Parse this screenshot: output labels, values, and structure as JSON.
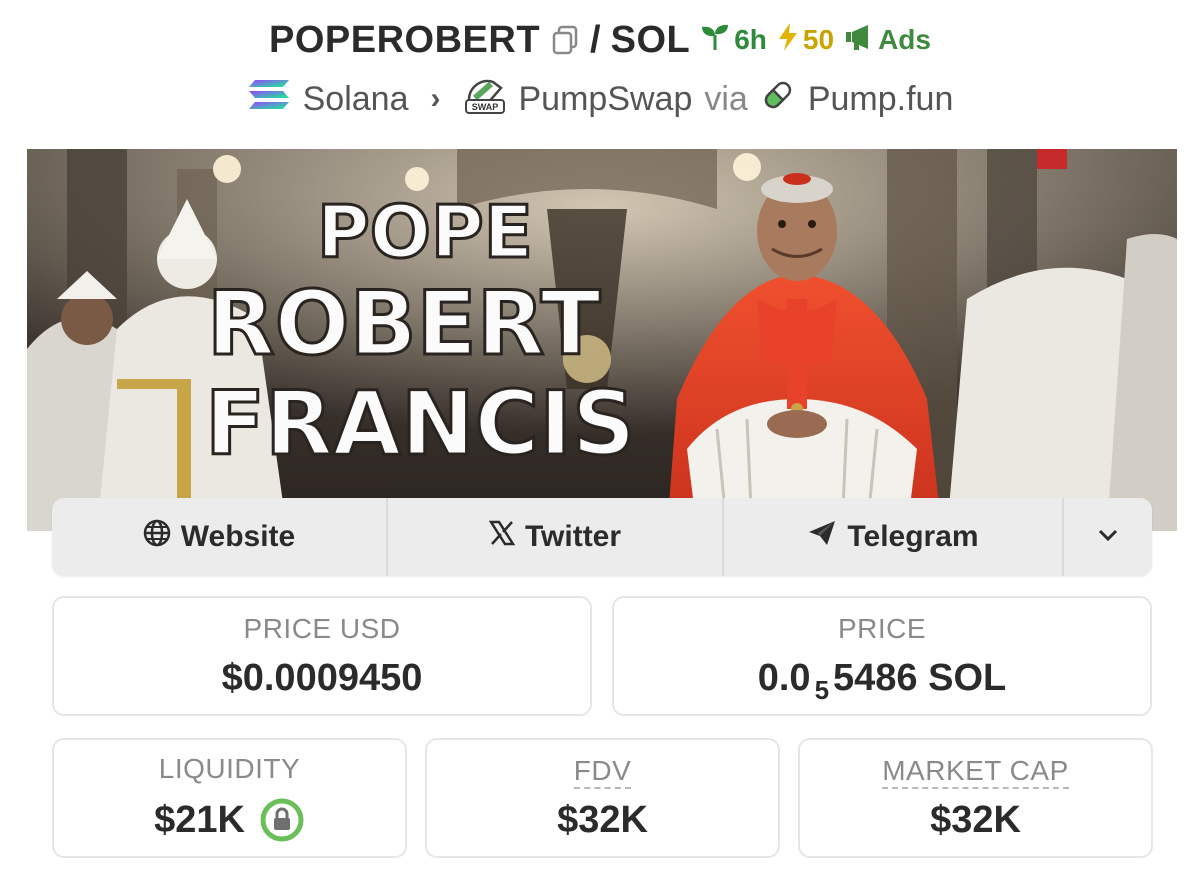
{
  "header": {
    "base_symbol": "POPEROBERT",
    "separator": "/",
    "quote_symbol": "SOL",
    "age": "6h",
    "boosts": "50",
    "ads_label": "Ads"
  },
  "chain": {
    "chain_name": "Solana",
    "dex_name": "PumpSwap",
    "via_label": "via",
    "launchpad_name": "Pump.fun",
    "dex_icon_text": "SWAP"
  },
  "banner": {
    "line1": "POPE",
    "line2": "ROBERT",
    "line3": "FRANCIS"
  },
  "links": {
    "website": "Website",
    "twitter": "Twitter",
    "telegram": "Telegram"
  },
  "stats": {
    "price_usd_label": "PRICE USD",
    "price_usd_value": "$0.0009450",
    "price_label": "PRICE",
    "price_prefix": "0.0",
    "price_zeros": "5",
    "price_suffix": "5486 SOL",
    "liquidity_label": "LIQUIDITY",
    "liquidity_value": "$21K",
    "fdv_label": "FDV",
    "fdv_value": "$32K",
    "mcap_label": "MARKET CAP",
    "mcap_value": "$32K"
  },
  "colors": {
    "age_green": "#2e8b3a",
    "boost_yellow": "#c9a400",
    "ads_green": "#3f8a3f",
    "lock_green": "#6bbf5a"
  },
  "icons": [
    "copy-icon",
    "seedling-icon",
    "bolt-icon",
    "megaphone-icon",
    "solana-icon",
    "pumpswap-icon",
    "pill-icon",
    "globe-icon",
    "x-icon",
    "send-icon",
    "chevron-down-icon",
    "lock-icon"
  ]
}
